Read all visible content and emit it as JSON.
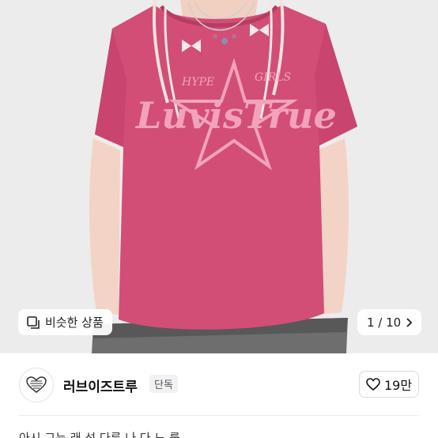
{
  "product_image": {
    "print_text_main": "LuvisTrue",
    "print_text_left": "HYPE",
    "print_text_right": "GIRLS",
    "shirt_color": "#d24e77",
    "print_color": "#f2a3bb"
  },
  "similar_button": {
    "label": "비슷한 상품",
    "icon": "similar-items-icon"
  },
  "image_counter": {
    "current": "1",
    "total": "10",
    "text": "1 / 10"
  },
  "seller": {
    "name": "러브이즈트루",
    "badge": "단독",
    "avatar_icon": "brand-logo-heart"
  },
  "like_button": {
    "count": "19만",
    "icon": "heart-icon"
  },
  "description_peek": "아시 그는 래 성 다른 나 다 느 를"
}
